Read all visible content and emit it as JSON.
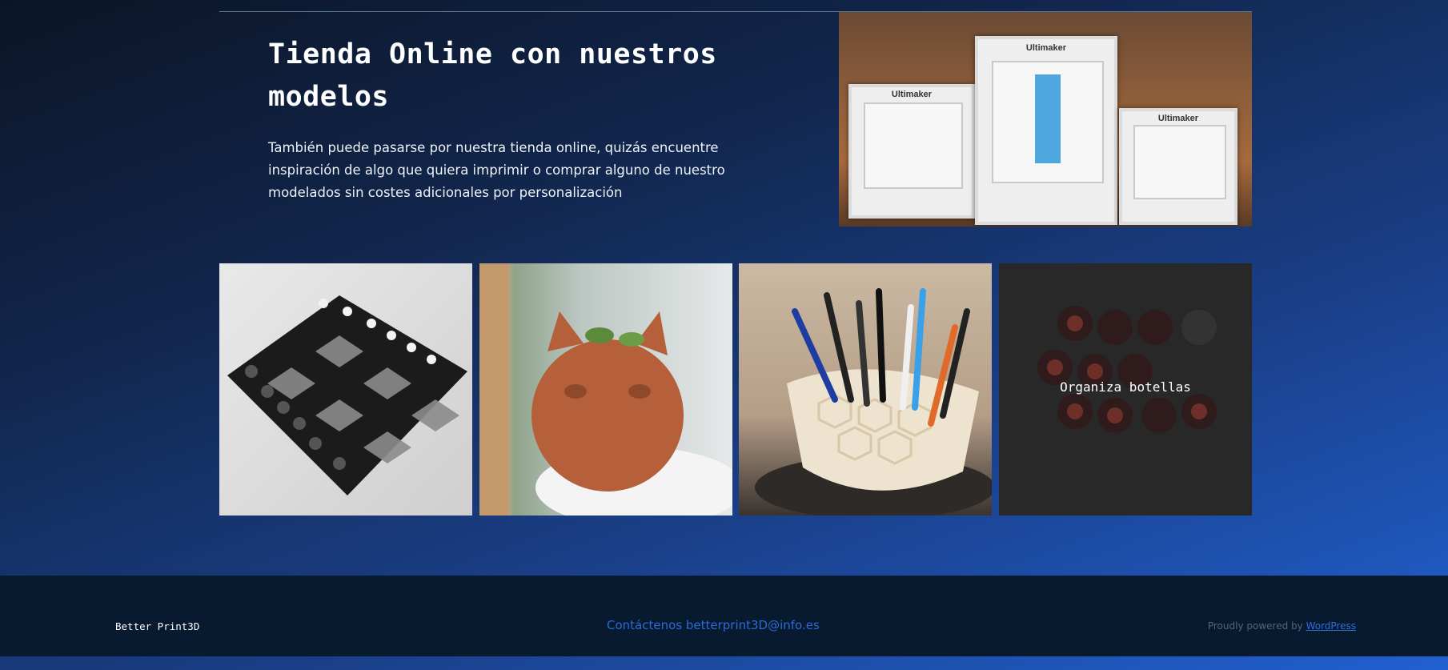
{
  "hero": {
    "title": "Tienda Online con nuestros modelos",
    "description": "También puede pasarse por nuestra tienda online, quizás encuentre inspiración de algo que quiera imprimir o comprar alguno de nuestro modelados sin costes adicionales por personalización",
    "image_brand": "Ultimaker"
  },
  "gallery": {
    "tiles": [
      {
        "label": ""
      },
      {
        "label": ""
      },
      {
        "label": ""
      },
      {
        "label": "Organiza botellas"
      }
    ]
  },
  "footer": {
    "site_name": "Better Print3D",
    "contact": "Contáctenos betterprint3D@info.es",
    "powered_prefix": "Proudly powered by",
    "powered_link": "WordPress"
  },
  "colors": {
    "accent": "#2c6ed8",
    "footer_bg": "#081a30"
  }
}
